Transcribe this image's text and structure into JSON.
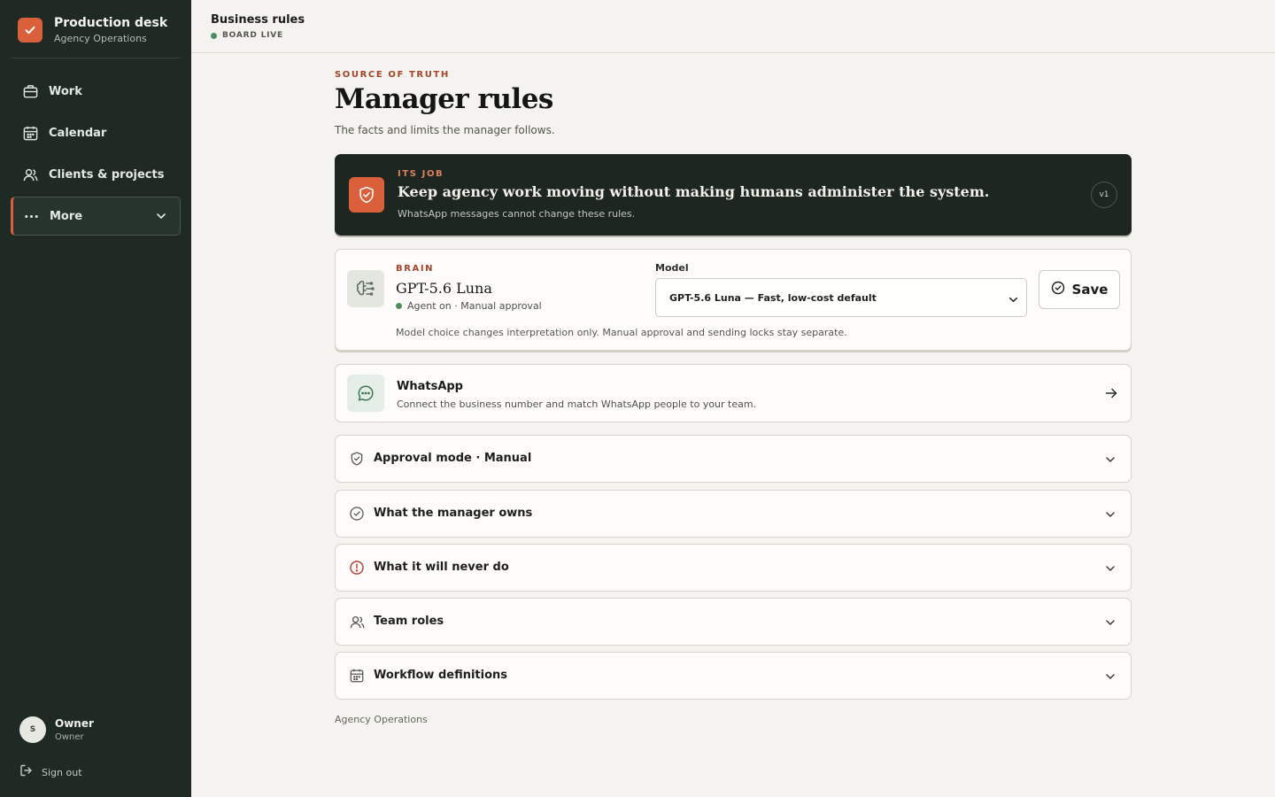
{
  "sidebar": {
    "brand_title": "Production desk",
    "brand_subtitle": "Agency Operations",
    "nav": [
      {
        "label": "Work",
        "icon": "briefcase-icon"
      },
      {
        "label": "Calendar",
        "icon": "calendar-icon"
      },
      {
        "label": "Clients & projects",
        "icon": "users-icon"
      },
      {
        "label": "More",
        "icon": "more-icon",
        "active": true
      }
    ],
    "user": {
      "initial": "S",
      "name": "Owner",
      "role": "Owner"
    },
    "sign_out": "Sign out"
  },
  "header": {
    "title": "Business rules",
    "status": "BOARD LIVE"
  },
  "page": {
    "eyebrow": "SOURCE OF TRUTH",
    "title": "Manager rules",
    "subtitle": "The facts and limits the manager follows."
  },
  "job": {
    "eyebrow": "ITS JOB",
    "title": "Keep agency work moving without making humans administer the system.",
    "subtitle": "WhatsApp messages cannot change these rules.",
    "version": "v1"
  },
  "brain": {
    "eyebrow": "BRAIN",
    "title": "GPT-5.6 Luna",
    "status": "Agent on · Manual approval",
    "model_label": "Model",
    "model_selected": "GPT-5.6 Luna — Fast, low-cost default",
    "save_label": "Save",
    "note": "Model choice changes interpretation only. Manual approval and sending locks stay separate."
  },
  "whatsapp": {
    "title": "WhatsApp",
    "subtitle": "Connect the business number and match WhatsApp people to your team."
  },
  "sections": [
    {
      "label": "Approval mode · Manual",
      "icon": "shield-icon"
    },
    {
      "label": "What the manager owns",
      "icon": "check-circle-icon"
    },
    {
      "label": "What it will never do",
      "icon": "alert-circle-icon"
    },
    {
      "label": "Team roles",
      "icon": "users-icon"
    },
    {
      "label": "Workflow definitions",
      "icon": "calendar-icon"
    }
  ],
  "footer": "Agency Operations",
  "colors": {
    "sidebar_bg": "#1f2a24",
    "accent": "#d9603b",
    "eyebrow": "#a3452a",
    "status_green": "#4f8f5e",
    "page_bg": "#f4f3ef"
  }
}
